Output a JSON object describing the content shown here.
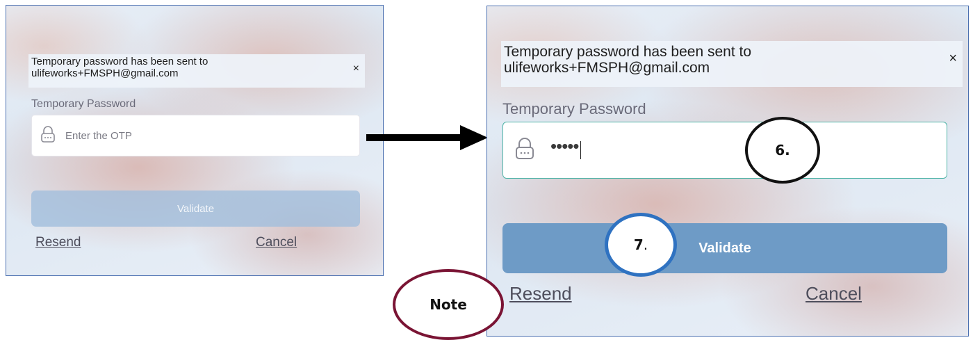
{
  "before": {
    "message_line1": "Temporary password has been sent to",
    "message_line2": "ulifeworks+FMSPH@gmail.com",
    "close": "×",
    "field_label": "Temporary Password",
    "input_placeholder": "Enter the OTP",
    "validate_label": "Validate",
    "resend_label": "Resend",
    "cancel_label": "Cancel"
  },
  "after": {
    "message_line1": "Temporary password has been sent to",
    "message_line2": "ulifeworks+FMSPH@gmail.com",
    "close": "×",
    "field_label": "Temporary Password",
    "input_value": "•••••",
    "validate_label": "Validate",
    "resend_label": "Resend",
    "cancel_label": "Cancel"
  },
  "callouts": {
    "step6": "6.",
    "step7_number": "7",
    "step7_dot": ".",
    "note": "Note"
  },
  "colors": {
    "panel_border": "#4a6fb0",
    "validate_active": "#6e9bc6",
    "input_focus_border": "#4db3a6",
    "callout_step6": "#111111",
    "callout_step7": "#2f72c1",
    "callout_note": "#7a1434"
  },
  "icons": {
    "lock": "lock-icon",
    "arrow": "right-arrow-icon",
    "close": "close-icon"
  }
}
